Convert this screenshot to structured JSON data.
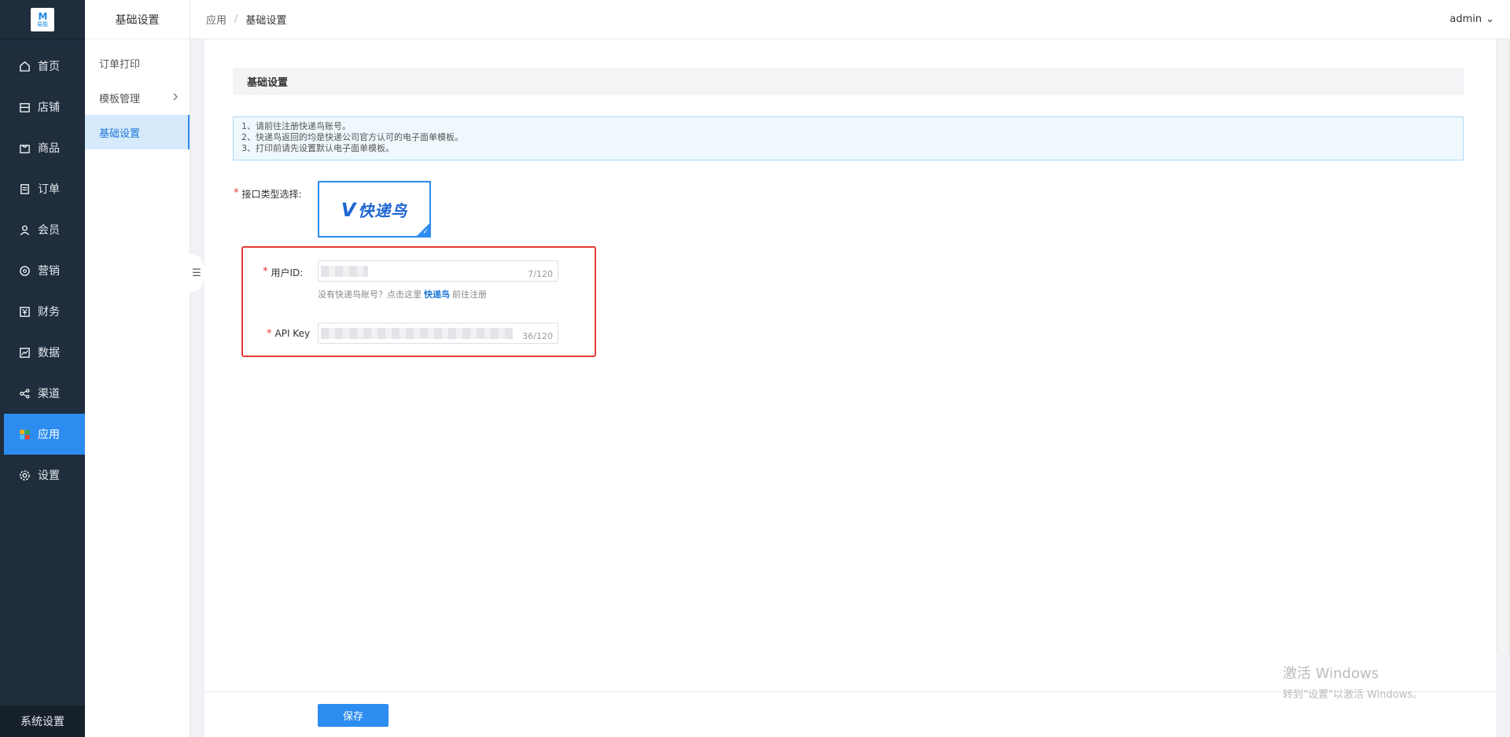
{
  "logo": {
    "mark": "M",
    "text": "易能"
  },
  "sidebar": {
    "items": [
      {
        "label": "首页",
        "icon": "home-icon"
      },
      {
        "label": "店铺",
        "icon": "store-icon"
      },
      {
        "label": "商品",
        "icon": "bag-icon"
      },
      {
        "label": "订单",
        "icon": "order-icon"
      },
      {
        "label": "会员",
        "icon": "user-icon"
      },
      {
        "label": "营销",
        "icon": "marketing-icon"
      },
      {
        "label": "财务",
        "icon": "yen-icon"
      },
      {
        "label": "数据",
        "icon": "chart-icon"
      },
      {
        "label": "渠道",
        "icon": "channel-icon"
      },
      {
        "label": "应用",
        "icon": "apps-icon"
      },
      {
        "label": "设置",
        "icon": "gear-icon"
      }
    ],
    "active_index": 9,
    "system_settings": "系统设置"
  },
  "submenu": {
    "title": "基础设置",
    "items": [
      {
        "label": "订单打印"
      },
      {
        "label": "模板管理"
      },
      {
        "label": "基础设置"
      }
    ],
    "collapse_glyph": "☰"
  },
  "topbar": {
    "breadcrumb": [
      "应用",
      "基础设置"
    ],
    "separator": "/",
    "user": "admin",
    "caret": "⌄"
  },
  "main": {
    "section_title": "基础设置",
    "notice": [
      "1、请前往注册快递鸟账号。",
      "2、快递鸟返回的均是快递公司官方认可的电子面单模板。",
      "3、打印前请先设置默认电子面单模板。"
    ],
    "api_type_label": "接口类型选择:",
    "api_choice": {
      "v": "V",
      "brand": "快递鸟"
    },
    "user_id": {
      "label": "用户ID:",
      "count": "7/120"
    },
    "hint": {
      "prefix": "没有快递鸟账号？点击这里",
      "link": "快递鸟",
      "suffix": "前往注册"
    },
    "api_key": {
      "label": "API Key",
      "count": "36/120"
    },
    "save": "保存"
  },
  "watermark": {
    "line1": "激活 Windows",
    "line2": "转到\"设置\"以激活 Windows。"
  },
  "colors": {
    "sidebar": "#1f2d3d",
    "accent": "#2d8cf0",
    "required": "#e53935"
  }
}
